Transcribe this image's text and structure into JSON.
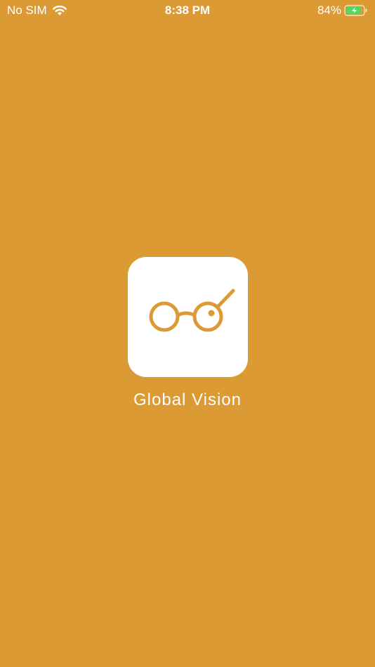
{
  "status_bar": {
    "carrier": "No SIM",
    "time": "8:38 PM",
    "battery_percent": "84%",
    "battery_level": 0.84,
    "charging": true,
    "wifi_icon": "wifi-icon",
    "battery_icon": "battery-charging-icon"
  },
  "splash": {
    "app_name": "Global Vision",
    "logo_icon": "glasses-icon"
  },
  "colors": {
    "background": "#DB9A33",
    "logo_tile": "#FFFFFF",
    "accent": "#DB9A33",
    "battery_fill": "#4CD964"
  }
}
